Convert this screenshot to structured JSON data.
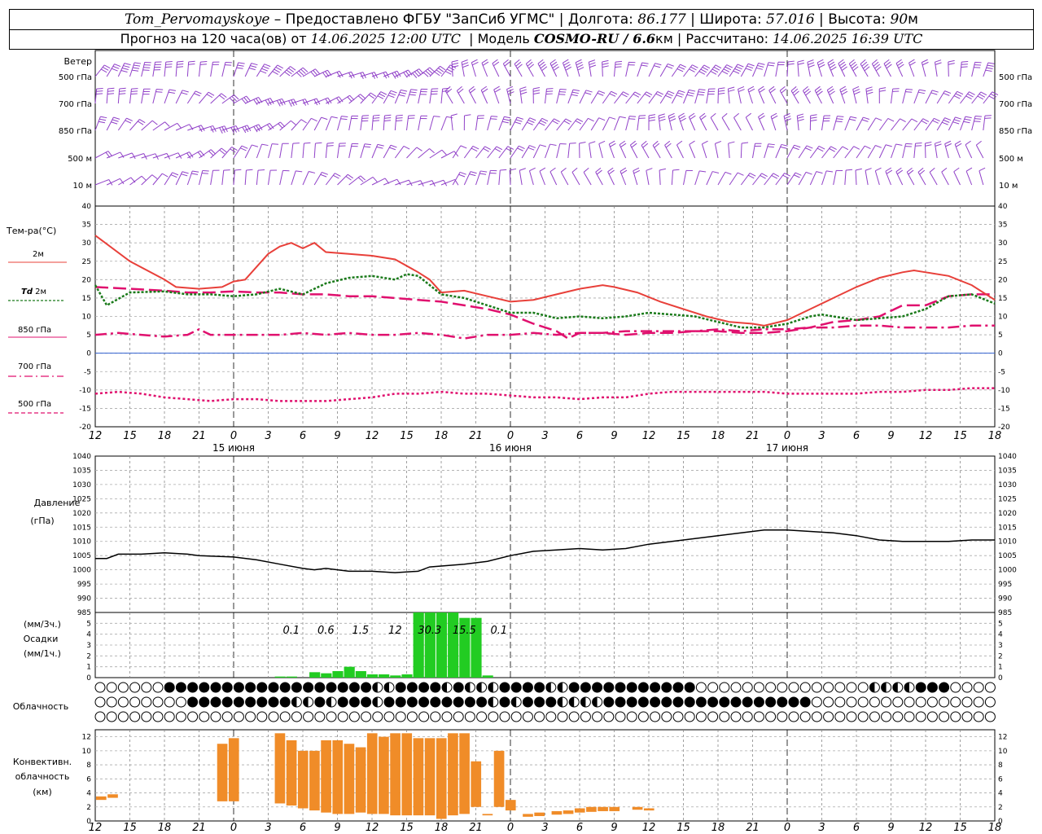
{
  "header": {
    "station": "Tom_Pervomayskoye",
    "provider": "– Предоставлено ФГБУ \"ЗапСиб УГМС\"",
    "lon_label": "Долгота:",
    "lon": "86.177",
    "lat_label": "Широта:",
    "lat": "57.016",
    "alt_label": "Высота:",
    "alt": "90",
    "alt_unit": "м",
    "forecast_label": "Прогноз на 120 часа(ов) от",
    "forecast_from": "14.06.2025 12:00 UTC",
    "model_label": "Модель",
    "model": "COSMO-RU / 6.6",
    "model_unit": "км",
    "calc_label": "Рассчитано:",
    "calc_time": "14.06.2025 16:39 UTC"
  },
  "labels": {
    "wind": "Ветер",
    "wind_levels": [
      "500 гПа",
      "700 гПа",
      "850 гПа",
      "500 м",
      "10 м"
    ],
    "temp_title": "Тем-ра(°С)",
    "temp_2m": "2м",
    "td_prefix": "Td",
    "td_2m": "2м",
    "t850": "850 гПа",
    "t700": "700 гПа",
    "t500": "500 гПа",
    "pressure_title": "Давление",
    "pressure_unit": "(гПа)",
    "precip_unit3": "(мм/3ч.)",
    "precip_title": "Осадки",
    "precip_unit1": "(мм/1ч.)",
    "cloud_title": "Облачность",
    "conv_title1": "Конвективн.",
    "conv_title2": "облачность",
    "conv_unit": "(км)"
  },
  "colors": {
    "t2m": "#e8403a",
    "td2m": "#1a7a1a",
    "upper": "#e0106e",
    "wind": "#9040c8",
    "precip": "#22cc22",
    "conv": "#f08c28",
    "zero": "#3060d0"
  },
  "chart_data": {
    "type": "line",
    "hour_ticks": [
      "12",
      "15",
      "18",
      "21",
      "0",
      "3",
      "6",
      "9",
      "12",
      "15",
      "18",
      "21",
      "0",
      "3",
      "6",
      "9",
      "12",
      "15",
      "18",
      "21",
      "0",
      "3",
      "6",
      "9",
      "12",
      "15",
      "18"
    ],
    "date_labels": [
      {
        "after_hour": 12,
        "text": "15 июня"
      },
      {
        "after_hour": 36,
        "text": "16 июня"
      },
      {
        "after_hour": 60,
        "text": "17 июня"
      }
    ],
    "x_range_hours": [
      0,
      78
    ],
    "temperature": {
      "ylim": [
        -20,
        40
      ],
      "ticks": [
        40,
        35,
        30,
        25,
        20,
        15,
        10,
        5,
        0,
        -5,
        -10,
        -15,
        -20
      ],
      "t2m": [
        [
          0,
          32
        ],
        [
          3,
          25
        ],
        [
          6,
          20
        ],
        [
          7,
          18
        ],
        [
          9,
          17.5
        ],
        [
          11,
          18
        ],
        [
          12,
          19.5
        ],
        [
          13,
          20
        ],
        [
          15,
          27
        ],
        [
          16,
          29
        ],
        [
          17,
          30
        ],
        [
          18,
          28.5
        ],
        [
          19,
          30
        ],
        [
          20,
          27.5
        ],
        [
          22,
          27
        ],
        [
          24,
          26.5
        ],
        [
          26,
          25.5
        ],
        [
          28,
          22
        ],
        [
          29,
          20
        ],
        [
          30,
          16.5
        ],
        [
          32,
          17
        ],
        [
          34,
          15.5
        ],
        [
          36,
          14
        ],
        [
          38,
          14.5
        ],
        [
          40,
          16
        ],
        [
          42,
          17.5
        ],
        [
          44,
          18.5
        ],
        [
          45,
          18
        ],
        [
          47,
          16.5
        ],
        [
          49,
          14
        ],
        [
          51,
          12
        ],
        [
          53,
          10
        ],
        [
          55,
          8.5
        ],
        [
          57,
          8
        ],
        [
          58,
          7.5
        ],
        [
          60,
          9
        ],
        [
          62,
          12
        ],
        [
          64,
          15
        ],
        [
          66,
          18
        ],
        [
          68,
          20.5
        ],
        [
          70,
          22
        ],
        [
          71,
          22.5
        ],
        [
          72,
          22
        ],
        [
          74,
          21
        ],
        [
          76,
          18.5
        ],
        [
          78,
          14.5
        ]
      ],
      "td2m": [
        [
          0,
          18.5
        ],
        [
          1,
          13
        ],
        [
          3,
          16.5
        ],
        [
          6,
          16.8
        ],
        [
          8,
          16
        ],
        [
          10,
          16
        ],
        [
          12,
          15.5
        ],
        [
          14,
          16
        ],
        [
          16,
          17.5
        ],
        [
          18,
          16
        ],
        [
          20,
          19
        ],
        [
          22,
          20.5
        ],
        [
          24,
          21
        ],
        [
          26,
          20
        ],
        [
          27,
          21.5
        ],
        [
          28,
          21
        ],
        [
          30,
          16
        ],
        [
          32,
          15
        ],
        [
          34,
          13
        ],
        [
          36,
          11
        ],
        [
          38,
          11
        ],
        [
          40,
          9.5
        ],
        [
          42,
          10
        ],
        [
          44,
          9.5
        ],
        [
          46,
          10
        ],
        [
          48,
          11
        ],
        [
          50,
          10.5
        ],
        [
          52,
          10
        ],
        [
          54,
          8.5
        ],
        [
          56,
          7
        ],
        [
          58,
          7
        ],
        [
          60,
          8
        ],
        [
          62,
          10
        ],
        [
          63,
          10.5
        ],
        [
          64,
          10
        ],
        [
          66,
          9
        ],
        [
          68,
          9.5
        ],
        [
          70,
          10
        ],
        [
          72,
          12
        ],
        [
          74,
          15.5
        ],
        [
          76,
          16
        ],
        [
          78,
          13.5
        ]
      ],
      "t850": [
        [
          0,
          18
        ],
        [
          3,
          17.5
        ],
        [
          6,
          17
        ],
        [
          8,
          16.5
        ],
        [
          10,
          16.5
        ],
        [
          12,
          16.8
        ],
        [
          14,
          16.5
        ],
        [
          16,
          16.5
        ],
        [
          18,
          16
        ],
        [
          20,
          16
        ],
        [
          22,
          15.5
        ],
        [
          24,
          15.5
        ],
        [
          26,
          15
        ],
        [
          28,
          14.5
        ],
        [
          30,
          14
        ],
        [
          32,
          13
        ],
        [
          34,
          12
        ],
        [
          36,
          10.5
        ],
        [
          38,
          8
        ],
        [
          40,
          6
        ],
        [
          41,
          4
        ],
        [
          42,
          5.5
        ],
        [
          44,
          5.5
        ],
        [
          46,
          5
        ],
        [
          48,
          5.5
        ],
        [
          50,
          5.5
        ],
        [
          52,
          6
        ],
        [
          54,
          6
        ],
        [
          56,
          5.5
        ],
        [
          58,
          5.5
        ],
        [
          60,
          6
        ],
        [
          62,
          7
        ],
        [
          64,
          8.5
        ],
        [
          66,
          9
        ],
        [
          68,
          10
        ],
        [
          70,
          13
        ],
        [
          72,
          13
        ],
        [
          74,
          15.5
        ],
        [
          76,
          16
        ],
        [
          78,
          16
        ]
      ],
      "t700": [
        [
          0,
          5
        ],
        [
          2,
          5.5
        ],
        [
          4,
          5
        ],
        [
          6,
          4.5
        ],
        [
          8,
          5
        ],
        [
          9,
          6.5
        ],
        [
          10,
          5
        ],
        [
          12,
          5
        ],
        [
          14,
          5
        ],
        [
          16,
          5
        ],
        [
          18,
          5.5
        ],
        [
          20,
          5
        ],
        [
          22,
          5.5
        ],
        [
          24,
          5
        ],
        [
          26,
          5
        ],
        [
          28,
          5.5
        ],
        [
          30,
          5
        ],
        [
          32,
          4
        ],
        [
          34,
          5
        ],
        [
          36,
          5
        ],
        [
          38,
          5.5
        ],
        [
          40,
          5
        ],
        [
          42,
          5.5
        ],
        [
          44,
          5.5
        ],
        [
          46,
          6
        ],
        [
          48,
          6
        ],
        [
          50,
          6
        ],
        [
          52,
          6
        ],
        [
          54,
          6.5
        ],
        [
          56,
          6
        ],
        [
          58,
          6.5
        ],
        [
          60,
          6.5
        ],
        [
          62,
          7
        ],
        [
          64,
          7
        ],
        [
          66,
          7.5
        ],
        [
          68,
          7.5
        ],
        [
          70,
          7
        ],
        [
          72,
          7
        ],
        [
          74,
          7
        ],
        [
          76,
          7.5
        ],
        [
          78,
          7.5
        ]
      ],
      "t500": [
        [
          0,
          -11
        ],
        [
          2,
          -10.5
        ],
        [
          4,
          -11
        ],
        [
          6,
          -12
        ],
        [
          8,
          -12.5
        ],
        [
          10,
          -13
        ],
        [
          12,
          -12.5
        ],
        [
          14,
          -12.5
        ],
        [
          16,
          -13
        ],
        [
          18,
          -13
        ],
        [
          20,
          -13
        ],
        [
          22,
          -12.5
        ],
        [
          24,
          -12
        ],
        [
          26,
          -11
        ],
        [
          28,
          -11
        ],
        [
          30,
          -10.5
        ],
        [
          32,
          -11
        ],
        [
          34,
          -11
        ],
        [
          36,
          -11.5
        ],
        [
          38,
          -12
        ],
        [
          40,
          -12
        ],
        [
          42,
          -12.5
        ],
        [
          44,
          -12
        ],
        [
          46,
          -12
        ],
        [
          48,
          -11
        ],
        [
          50,
          -10.5
        ],
        [
          52,
          -10.5
        ],
        [
          54,
          -10.5
        ],
        [
          56,
          -10.5
        ],
        [
          58,
          -10.5
        ],
        [
          60,
          -11
        ],
        [
          62,
          -11
        ],
        [
          64,
          -11
        ],
        [
          66,
          -11
        ],
        [
          68,
          -10.5
        ],
        [
          70,
          -10.5
        ],
        [
          72,
          -10
        ],
        [
          74,
          -10
        ],
        [
          76,
          -9.5
        ],
        [
          78,
          -9.5
        ]
      ]
    },
    "pressure": {
      "ylim": [
        985,
        1040
      ],
      "ticks": [
        1040,
        1035,
        1030,
        1025,
        1020,
        1015,
        1010,
        1005,
        1000,
        995,
        990,
        985
      ],
      "values": [
        [
          0,
          1004
        ],
        [
          1,
          1004
        ],
        [
          2,
          1005.5
        ],
        [
          4,
          1005.5
        ],
        [
          6,
          1006
        ],
        [
          8,
          1005.5
        ],
        [
          9,
          1005
        ],
        [
          12,
          1004.5
        ],
        [
          14,
          1003.5
        ],
        [
          16,
          1002
        ],
        [
          18,
          1000.5
        ],
        [
          19,
          1000
        ],
        [
          20,
          1000.5
        ],
        [
          21,
          1000
        ],
        [
          22,
          999.5
        ],
        [
          24,
          999.5
        ],
        [
          26,
          999
        ],
        [
          28,
          999.5
        ],
        [
          29,
          1001
        ],
        [
          32,
          1002
        ],
        [
          34,
          1003
        ],
        [
          36,
          1005
        ],
        [
          38,
          1006.5
        ],
        [
          40,
          1007
        ],
        [
          42,
          1007.5
        ],
        [
          44,
          1007
        ],
        [
          46,
          1007.5
        ],
        [
          48,
          1009
        ],
        [
          50,
          1010
        ],
        [
          52,
          1011
        ],
        [
          54,
          1012
        ],
        [
          56,
          1013
        ],
        [
          58,
          1014
        ],
        [
          60,
          1014
        ],
        [
          62,
          1013.5
        ],
        [
          64,
          1013
        ],
        [
          66,
          1012
        ],
        [
          68,
          1010.5
        ],
        [
          70,
          1010
        ],
        [
          72,
          1010
        ],
        [
          74,
          1010
        ],
        [
          76,
          1010.5
        ],
        [
          78,
          1010.5
        ]
      ]
    },
    "precip": {
      "ylim": [
        0,
        6
      ],
      "ticks": [
        5,
        4,
        3,
        2,
        1,
        0
      ],
      "hourly": [
        [
          16,
          0.1
        ],
        [
          17,
          0.1
        ],
        [
          19,
          0.5
        ],
        [
          20,
          0.4
        ],
        [
          21,
          0.6
        ],
        [
          22,
          1
        ],
        [
          23,
          0.6
        ],
        [
          24,
          0.3
        ],
        [
          25,
          0.3
        ],
        [
          26,
          0.2
        ],
        [
          27,
          0.3
        ],
        [
          28,
          6
        ],
        [
          29,
          6
        ],
        [
          30,
          6
        ],
        [
          31,
          6
        ],
        [
          32,
          5.5
        ],
        [
          33,
          5.5
        ],
        [
          34,
          0.2
        ]
      ],
      "sum3h_labels": [
        [
          17,
          "0.1"
        ],
        [
          20,
          "0.6"
        ],
        [
          23,
          "1.5"
        ],
        [
          26,
          "12"
        ],
        [
          29,
          "30.3"
        ],
        [
          32,
          "15.5"
        ],
        [
          35,
          "0.1"
        ]
      ]
    },
    "cloud_rows": [
      "00000011111111111111111122111121222111122111111111110000000000000002222111000000000000000000000000000000000000000000000000000200000000000",
      "00000000111111111221211121111111112121112222111111111111111111000000000000000000000000000000000000000000000000000000000000000000000000000",
      "00000000000000000000000000000000000000000000000000000000000000000000000000000000000000000000000000000000000000000000000000000000000000000"
    ],
    "convective": {
      "ylim": [
        0,
        13
      ],
      "ticks": [
        12,
        10,
        8,
        6,
        4,
        2,
        0
      ],
      "bars": [
        [
          0.5,
          3,
          3.5
        ],
        [
          1.5,
          3.3,
          3.8
        ],
        [
          11,
          2.8,
          11
        ],
        [
          12,
          2.8,
          11.8
        ],
        [
          16,
          2.5,
          12.5
        ],
        [
          17,
          2.2,
          11.5
        ],
        [
          18,
          1.8,
          10
        ],
        [
          19,
          1.5,
          10
        ],
        [
          20,
          1.2,
          11.5
        ],
        [
          21,
          1,
          11.5
        ],
        [
          22,
          1,
          11
        ],
        [
          23,
          1.2,
          10.5
        ],
        [
          24,
          1,
          12.5
        ],
        [
          25,
          1,
          12
        ],
        [
          26,
          0.8,
          12.5
        ],
        [
          27,
          0.8,
          12.5
        ],
        [
          28,
          0.8,
          11.8
        ],
        [
          29,
          0.8,
          11.8
        ],
        [
          30,
          0.3,
          11.8
        ],
        [
          31,
          0.8,
          12.5
        ],
        [
          32,
          1,
          12.5
        ],
        [
          33,
          2,
          8.5
        ],
        [
          34,
          0.8,
          1
        ],
        [
          35,
          2,
          10
        ],
        [
          36,
          1.5,
          3
        ],
        [
          37.5,
          0.6,
          1
        ],
        [
          38.5,
          0.7,
          1.2
        ],
        [
          40,
          0.9,
          1.4
        ],
        [
          41,
          1,
          1.5
        ],
        [
          42,
          1.2,
          1.8
        ],
        [
          43,
          1.3,
          2
        ],
        [
          44,
          1.4,
          2
        ],
        [
          45,
          1.4,
          2
        ],
        [
          47,
          1.6,
          2
        ],
        [
          48,
          1.5,
          1.8
        ]
      ]
    }
  }
}
